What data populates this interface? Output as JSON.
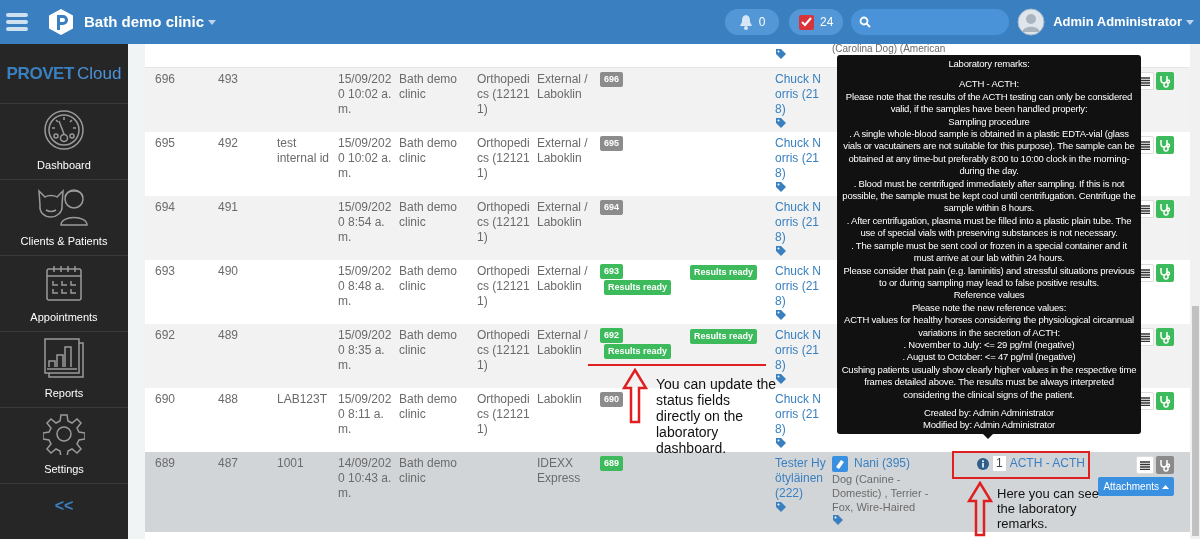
{
  "topbar": {
    "clinic": "Bath demo clinic",
    "notifications": "0",
    "tasks": "24",
    "user": "Admin Administrator"
  },
  "sidebar": {
    "logo_bold": "PROVET",
    "logo_light": "Cloud",
    "items": [
      {
        "kind": "dashboard",
        "label": "Dashboard"
      },
      {
        "kind": "clients",
        "label": "Clients & Patients"
      },
      {
        "kind": "appointments",
        "label": "Appointments"
      },
      {
        "kind": "reports",
        "label": "Reports"
      },
      {
        "kind": "settings",
        "label": "Settings"
      }
    ],
    "collapse": "<<"
  },
  "partial_row": {
    "patient": "(Carolina Dog) (American"
  },
  "rows": [
    {
      "id": "696",
      "request": "493",
      "internal_id": "",
      "date": "15/09/2020 10:02 a.m.",
      "clinic": "Bath demo clinic",
      "department": "Orthopedics (121211)",
      "laboratory": "External / Laboklin",
      "badge": {
        "text": "696",
        "color": "#8c8c8c"
      },
      "status_note": "",
      "result_status": "",
      "owner": "Chuck Norris (218)",
      "stethoscope_enabled": true,
      "selected": false
    },
    {
      "id": "695",
      "request": "492",
      "internal_id": "test internal id",
      "date": "15/09/2020 10:02 a.m.",
      "clinic": "Bath demo clinic",
      "department": "Orthopedics (121211)",
      "laboratory": "External / Laboklin",
      "badge": {
        "text": "695",
        "color": "#8c8c8c"
      },
      "status_note": "",
      "result_status": "",
      "owner": "Chuck Norris (218)",
      "stethoscope_enabled": true,
      "selected": false
    },
    {
      "id": "694",
      "request": "491",
      "internal_id": "",
      "date": "15/09/2020 8:54 a.m.",
      "clinic": "Bath demo clinic",
      "department": "Orthopedics (121211)",
      "laboratory": "External / Laboklin",
      "badge": {
        "text": "694",
        "color": "#8c8c8c"
      },
      "status_note": "",
      "result_status": "",
      "owner": "Chuck Norris (218)",
      "stethoscope_enabled": true,
      "selected": false
    },
    {
      "id": "693",
      "request": "490",
      "internal_id": "",
      "date": "15/09/2020 8:48 a.m.",
      "clinic": "Bath demo clinic",
      "department": "Orthopedics (121211)",
      "laboratory": "External / Laboklin",
      "badge": {
        "text": "693",
        "color": "#3dbb5c"
      },
      "status_note": "Results ready",
      "result_status": "Results ready",
      "owner": "Chuck Norris (218)",
      "stethoscope_enabled": true,
      "selected": false
    },
    {
      "id": "692",
      "request": "489",
      "internal_id": "",
      "date": "15/09/2020 8:35 a.m.",
      "clinic": "Bath demo clinic",
      "department": "Orthopedics (121211)",
      "laboratory": "External / Laboklin",
      "badge": {
        "text": "692",
        "color": "#3dbb5c"
      },
      "status_note": "Results ready",
      "result_status": "Results ready",
      "owner": "Chuck Norris (218)",
      "stethoscope_enabled": true,
      "selected": false
    },
    {
      "id": "690",
      "request": "488",
      "internal_id": "LAB123T",
      "date": "15/09/2020 8:11 a.m.",
      "clinic": "Bath demo clinic",
      "department": "Orthopedics (121211)",
      "laboratory": "Laboklin",
      "badge": {
        "text": "690",
        "color": "#8c8c8c"
      },
      "status_note": "",
      "result_status": "",
      "owner": "Chuck Norris (218)",
      "stethoscope_enabled": true,
      "selected": false
    },
    {
      "id": "689",
      "request": "487",
      "internal_id": "1001",
      "date": "14/09/2020 10:43 a.m.",
      "clinic": "Bath demo clinic",
      "department": "",
      "laboratory": "IDEXX Express",
      "badge": {
        "text": "689",
        "color": "#3dbb5c"
      },
      "status_note": "",
      "result_status": "",
      "owner": "Tester Hyötyläinen (222)",
      "patient_name": "Nani (395)",
      "patient_details": "Dog (Canine - Domestic) , Terrier - Fox, Wire-Haired",
      "test_count": "1",
      "test": "ACTH - ACTH",
      "attachments": "Attachments",
      "stethoscope_enabled": false,
      "selected": true
    }
  ],
  "tooltip": {
    "title": "Laboratory remarks:",
    "lines": [
      "ACTH - ACTH:",
      "Please note that the results of the ACTH testing can only be considered valid, if the samples have been handled properly:",
      "Sampling procedure",
      ". A single whole-blood sample is obtained in a plastic EDTA-vial (glass vials or vacutainers are not suitable for this purpose). The sample can be obtained at any time-but preferably 8:00 to 10:00 clock in the morning-during the day.",
      ". Blood must be centrifuged immediately after sampling. If this is not possible, the sample must be kept cool until centrifugation. Centrifuge the sample within 8 hours.",
      ". After centrifugation, plasma must be filled into a plastic plain tube. The use of special vials with preserving substances is not necessary.",
      ". The sample must be sent cool or frozen in a special container and it must arrive at our lab within 24 hours.",
      "Please consider that pain (e.g. laminitis) and stressful situations previous to or during sampling may lead to false positive results.",
      "Reference values",
      "Please note the new reference values:",
      "ACTH values for healthy horses considering the physiological circannual variations in the secretion of ACTH:",
      ". November to July:  <= 29 pg/ml (negative)",
      ". August to October:  <= 47 pg/ml (negative)",
      "Cushing patients usually show clearly higher values in the respective time frames detailed above. The results must be always interpreted considering the clinical signs of the patient."
    ],
    "created": "Created by: Admin Administrator",
    "modified": "Modified by: Admin Administrator"
  },
  "annotations": [
    {
      "text": "You can update the status fields directly on the laboratory dashboard."
    },
    {
      "text": "Here you can see the laboratory remarks."
    }
  ]
}
